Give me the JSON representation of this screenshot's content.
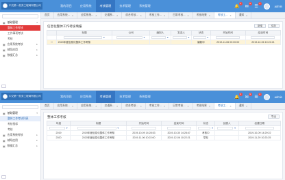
{
  "app": {
    "logo_text": "中交第一航务工程局有限公司",
    "user_name": "admin",
    "colors": {
      "topbar": "#4a90d9",
      "active_nav": "#3576c3",
      "sidebar_active": "#e23b3b"
    }
  },
  "nav": {
    "items": [
      "我的项目",
      "应用系统",
      "考核管理",
      "技术管理",
      "系统管理"
    ]
  },
  "topbar_icons": {
    "bell_badge": "3",
    "mail_badge": "9",
    "todo_badge": "4"
  },
  "screen1": {
    "tabs": [
      "首页",
      "应用系统...",
      "应用系统...",
      "交通系...",
      "综合考核...",
      "考核工作...",
      "日常考核...",
      "考核结果",
      "考核工...",
      "通知"
    ],
    "sidebar": {
      "menu": [
        {
          "label": "基础管理",
          "icon": "folder-icon",
          "open": true
        },
        {
          "label": "整体工作考核",
          "sub": true,
          "active": true
        },
        {
          "label": "工作事项考核",
          "sub": true
        },
        {
          "label": "考核",
          "sub": true
        },
        {
          "label": "应用系统考核",
          "icon": "folder-icon"
        },
        {
          "label": "辅导应用",
          "icon": "folder-icon"
        },
        {
          "label": "数据汇总",
          "icon": "folder-icon"
        }
      ]
    },
    "panel": {
      "title": "信息化整体工作考核填报",
      "buttons": [
        "新增",
        "保存"
      ],
      "columns": [
        "",
        "标题",
        "公司",
        "编制人",
        "发送人",
        "状态",
        "开始时间",
        "结束时间"
      ],
      "rows": [
        {
          "title": "2020年度信息化整体工作考核",
          "company": "",
          "author": "",
          "sender": "",
          "status": "编制中",
          "start": "2019-11-06 00:00:00",
          "end": "2019-12-06 10:22:21"
        }
      ]
    }
  },
  "screen2": {
    "tabs": [
      "首页",
      "应用系统...",
      "应用系统...",
      "交通系...",
      "综合考核...",
      "考核工作...",
      "日常考核...",
      "考核结果",
      "考核工...",
      "通知"
    ],
    "sidebar": {
      "menu": [
        {
          "label": "基础管理",
          "icon": "folder-icon",
          "open": true
        },
        {
          "label": "整体工作考核列表",
          "sub": true,
          "selected": true
        },
        {
          "label": "考核指标",
          "sub": true
        },
        {
          "label": "考核",
          "sub": true
        },
        {
          "label": "应用系统考核",
          "icon": "folder-icon"
        },
        {
          "label": "辅导应用",
          "icon": "folder-icon"
        },
        {
          "label": "数据汇总",
          "icon": "folder-icon"
        }
      ]
    },
    "panel": {
      "title": "整体工作考核",
      "buttons": [
        "导出"
      ],
      "columns": [
        "年度",
        "标题",
        "开始时间",
        "结束时间",
        "状态",
        "创建人",
        "创建日期"
      ],
      "rows": [
        {
          "year": "2019",
          "title": "2019年度信息化整体工作考核",
          "start": "2019-10-09 14:28:53",
          "end": "2019-10-30 14:28:47",
          "status": "考核中",
          "creator": "",
          "created": "2019-10-09 14:29:22"
        },
        {
          "year": "2020",
          "title": "2020年度信息化整体工作考核",
          "start": "2019-11-06 10:22:00",
          "end": "2019-12-06 10:22:21",
          "status": "草拟",
          "creator": "",
          "created": "2019-11-29 10:23:25"
        }
      ]
    }
  }
}
